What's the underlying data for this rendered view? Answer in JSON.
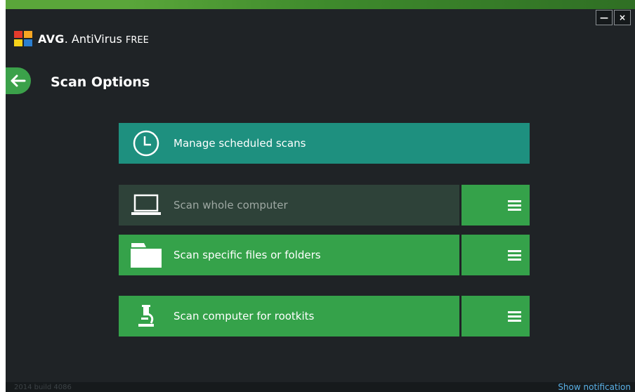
{
  "app": {
    "brand_avg": "AVG",
    "brand_product": "AntiVirus",
    "brand_edition": "FREE",
    "logo_icon": "avg-logo-icon"
  },
  "window_controls": {
    "minimize": "—",
    "close": "×"
  },
  "page": {
    "title": "Scan Options",
    "back_icon": "arrow-left-icon"
  },
  "manage": {
    "label": "Manage scheduled scans",
    "icon": "clock-icon"
  },
  "scans": [
    {
      "label": "Scan whole computer",
      "icon": "laptop-icon",
      "state": "disabled"
    },
    {
      "label": "Scan specific files or folders",
      "icon": "folder-icon",
      "state": "enabled"
    },
    {
      "label": "Scan computer for rootkits",
      "icon": "microscope-icon",
      "state": "enabled"
    }
  ],
  "footer": {
    "build": "2014  build 4086",
    "show_notification": "Show notification"
  },
  "colors": {
    "background": "#1f2326",
    "accent_green": "#35a24a",
    "accent_teal": "#1e907f",
    "disabled": "#2e4239",
    "link": "#5ab0e6"
  }
}
